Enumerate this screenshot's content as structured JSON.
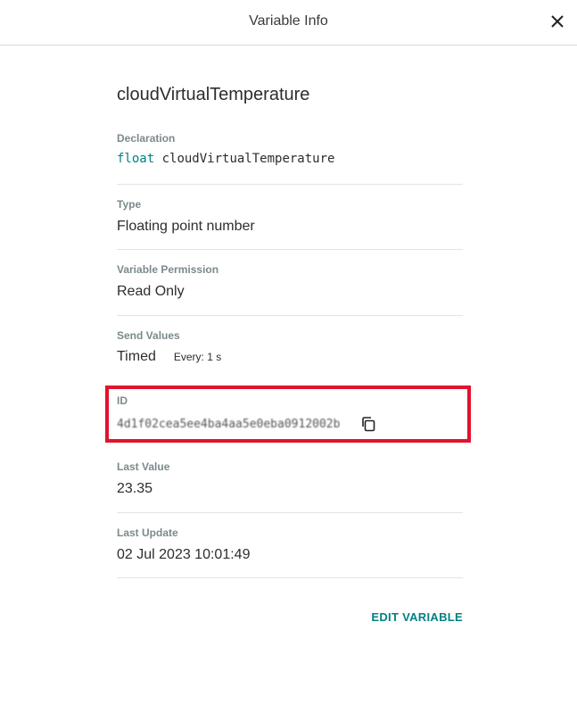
{
  "header": {
    "title": "Variable Info",
    "close_icon": "close-icon"
  },
  "variable": {
    "name": "cloudVirtualTemperature"
  },
  "fields": {
    "declaration": {
      "label": "Declaration",
      "type_keyword": "float",
      "name": "cloudVirtualTemperature"
    },
    "type": {
      "label": "Type",
      "value": "Floating point number"
    },
    "permission": {
      "label": "Variable Permission",
      "value": "Read Only"
    },
    "send_values": {
      "label": "Send Values",
      "mode": "Timed",
      "interval": "Every: 1 s"
    },
    "id": {
      "label": "ID",
      "value": "4d1f02cea5ee4ba4aa5e0eba0912002b",
      "obscured": true,
      "copy_icon": "copy-icon"
    },
    "last_value": {
      "label": "Last Value",
      "value": "23.35"
    },
    "last_update": {
      "label": "Last Update",
      "value": "02 Jul 2023 10:01:49"
    }
  },
  "actions": {
    "edit_label": "EDIT VARIABLE"
  },
  "colors": {
    "accent": "#008184",
    "highlight_box": "#e0142e",
    "label": "#7a8a8c",
    "divider": "#e3e3e3"
  }
}
